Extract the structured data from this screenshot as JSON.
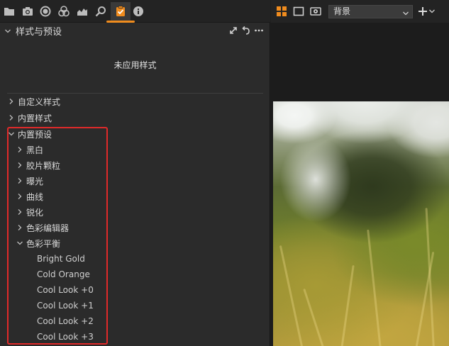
{
  "toolbar": {
    "icons": [
      "folder-icon",
      "camera-icon",
      "circle-icon",
      "color-circles-icon",
      "histogram-icon",
      "search-icon",
      "styles-badge-icon",
      "info-icon"
    ],
    "accent": "#f08c1e"
  },
  "panel": {
    "title": "样式与预设",
    "status": "未应用样式"
  },
  "tree": {
    "custom_styles": "自定义样式",
    "builtin_styles": "内置样式",
    "builtin_presets": "内置预设",
    "groups": [
      "黑白",
      "胶片颗粒",
      "曝光",
      "曲线",
      "锐化",
      "色彩编辑器"
    ],
    "color_balance": "色彩平衡",
    "presets": [
      "Bright Gold",
      "Cold Orange",
      "Cool Look +0",
      "Cool Look +1",
      "Cool Look +2",
      "Cool Look +3"
    ]
  },
  "viewer": {
    "background_select": "背景"
  },
  "colors": {
    "highlight": "#e12a2a"
  }
}
